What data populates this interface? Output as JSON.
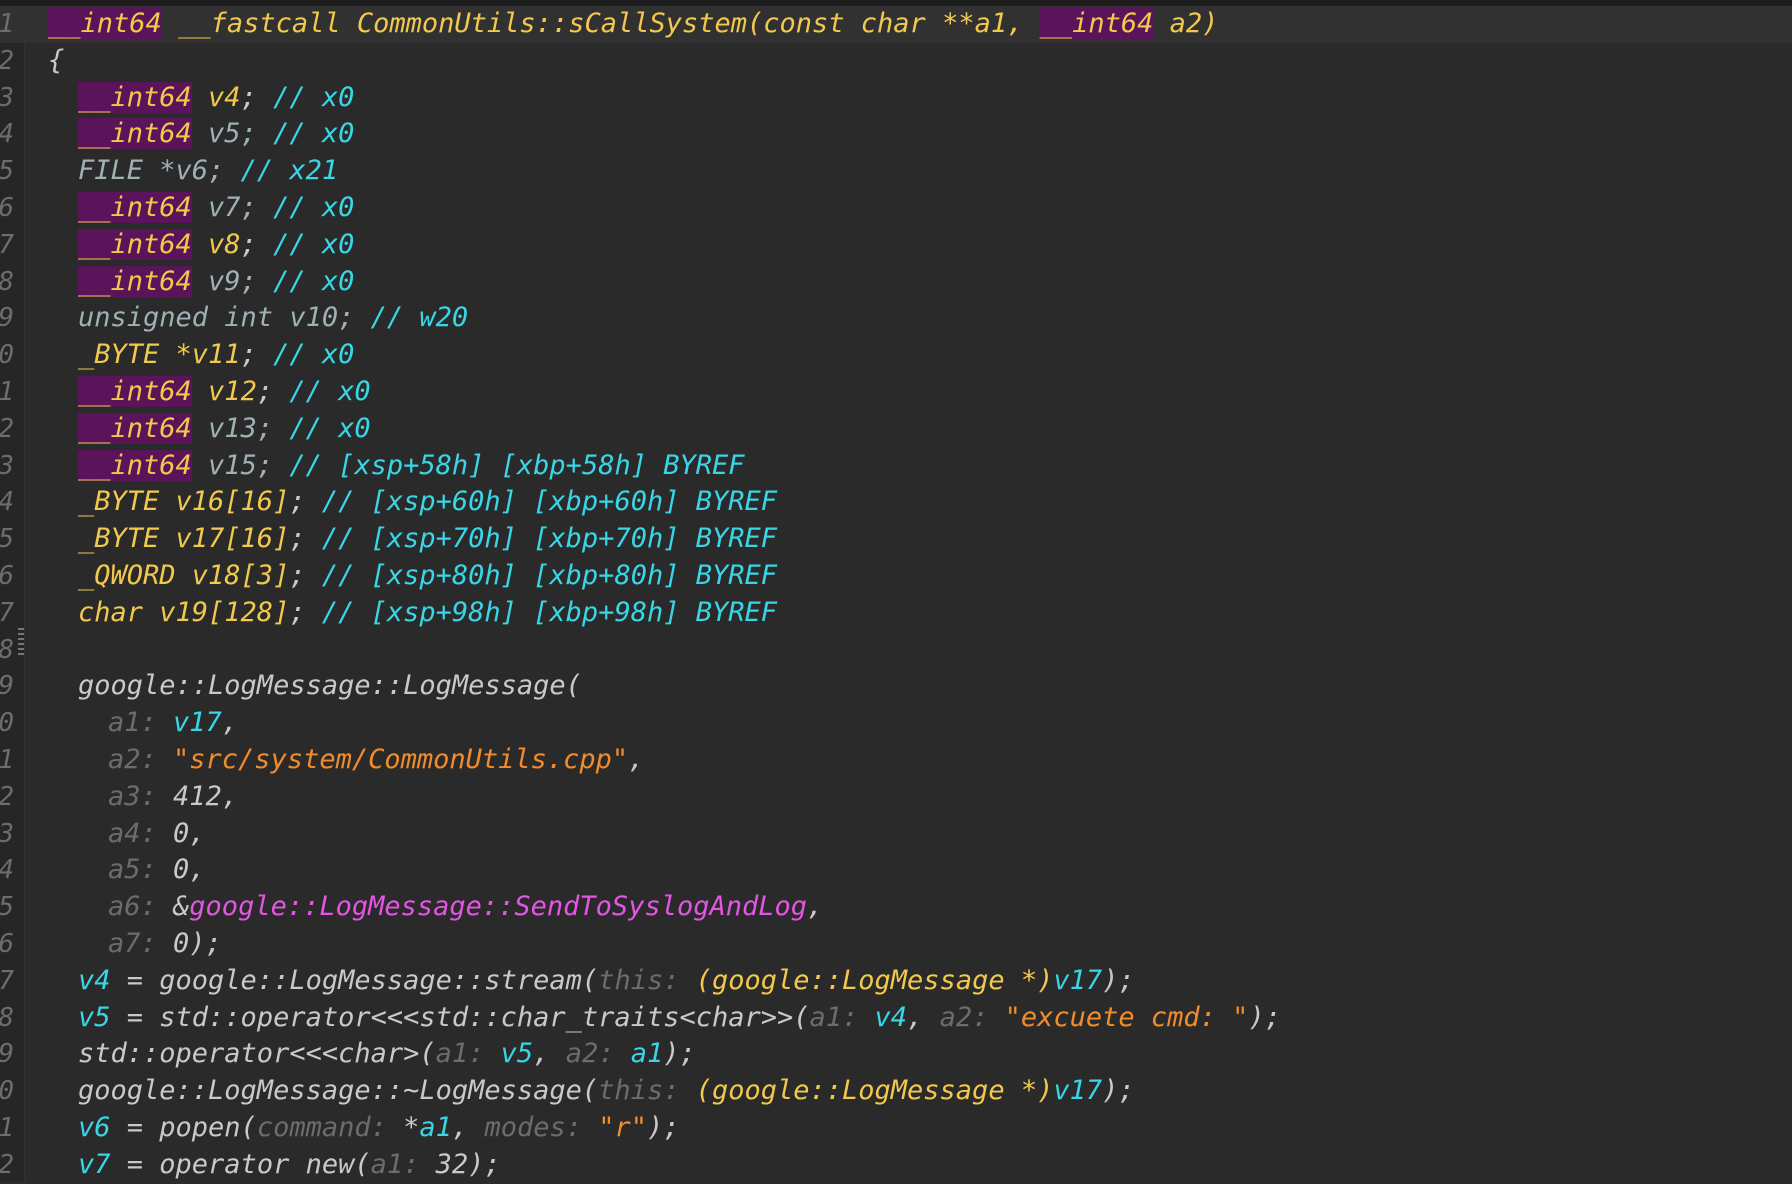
{
  "colors": {
    "background": "#2a2a2a",
    "keyword": "#f2c94c",
    "variable": "#38d6e6",
    "string": "#f28c2a",
    "import": "#e455e4",
    "hint": "#6c6c6c",
    "highlight": "#5b1459"
  },
  "lines": [
    {
      "n": "1",
      "indent": 48,
      "current": true,
      "tokens": [
        {
          "c": "hl",
          "t": "__int64"
        },
        {
          "c": "def",
          "t": " "
        },
        {
          "c": "kw",
          "t": "__fastcall CommonUtils::sCallSystem(const char **a1, "
        },
        {
          "c": "hl",
          "t": "__int64"
        },
        {
          "c": "kw",
          "t": " a2)"
        }
      ]
    },
    {
      "n": "2",
      "indent": 48,
      "tokens": [
        {
          "c": "def",
          "t": "{"
        }
      ]
    },
    {
      "n": "3",
      "indent": 78,
      "tokens": [
        {
          "c": "hl",
          "t": "__int64"
        },
        {
          "c": "kw",
          "t": " v4"
        },
        {
          "c": "def",
          "t": "; "
        },
        {
          "c": "cmt",
          "t": "// x0"
        }
      ]
    },
    {
      "n": "4",
      "indent": 78,
      "tokens": [
        {
          "c": "hl",
          "t": "__int64"
        },
        {
          "c": "dim",
          "t": " v5; "
        },
        {
          "c": "cmt",
          "t": "// x0"
        }
      ]
    },
    {
      "n": "5",
      "indent": 78,
      "tokens": [
        {
          "c": "dim",
          "t": "FILE *v6; "
        },
        {
          "c": "cmt",
          "t": "// x21"
        }
      ]
    },
    {
      "n": "6",
      "indent": 78,
      "tokens": [
        {
          "c": "hl",
          "t": "__int64"
        },
        {
          "c": "dim",
          "t": " v7; "
        },
        {
          "c": "cmt",
          "t": "// x0"
        }
      ]
    },
    {
      "n": "7",
      "indent": 78,
      "tokens": [
        {
          "c": "hl",
          "t": "__int64"
        },
        {
          "c": "kw",
          "t": " v8"
        },
        {
          "c": "def",
          "t": "; "
        },
        {
          "c": "cmt",
          "t": "// x0"
        }
      ]
    },
    {
      "n": "8",
      "indent": 78,
      "tokens": [
        {
          "c": "hl",
          "t": "__int64"
        },
        {
          "c": "dim",
          "t": " v9; "
        },
        {
          "c": "cmt",
          "t": "// x0"
        }
      ]
    },
    {
      "n": "9",
      "indent": 78,
      "tokens": [
        {
          "c": "dim",
          "t": "unsigned int v10; "
        },
        {
          "c": "cmt",
          "t": "// w20"
        }
      ]
    },
    {
      "n": "0",
      "indent": 78,
      "tokens": [
        {
          "c": "kw",
          "t": "_BYTE *v11"
        },
        {
          "c": "def",
          "t": "; "
        },
        {
          "c": "cmt",
          "t": "// x0"
        }
      ]
    },
    {
      "n": "1",
      "indent": 78,
      "tokens": [
        {
          "c": "hl",
          "t": "__int64"
        },
        {
          "c": "kw",
          "t": " v12"
        },
        {
          "c": "def",
          "t": "; "
        },
        {
          "c": "cmt",
          "t": "// x0"
        }
      ]
    },
    {
      "n": "2",
      "indent": 78,
      "tokens": [
        {
          "c": "hl",
          "t": "__int64"
        },
        {
          "c": "dim",
          "t": " v13; "
        },
        {
          "c": "cmt",
          "t": "// x0"
        }
      ]
    },
    {
      "n": "3",
      "indent": 78,
      "tokens": [
        {
          "c": "hl",
          "t": "__int64"
        },
        {
          "c": "dim",
          "t": " v15; "
        },
        {
          "c": "cmt",
          "t": "// [xsp+58h] [xbp+58h] BYREF"
        }
      ]
    },
    {
      "n": "4",
      "indent": 78,
      "tokens": [
        {
          "c": "kw",
          "t": "_BYTE v16[16]"
        },
        {
          "c": "def",
          "t": "; "
        },
        {
          "c": "cmt",
          "t": "// [xsp+60h] [xbp+60h] BYREF"
        }
      ]
    },
    {
      "n": "5",
      "indent": 78,
      "tokens": [
        {
          "c": "kw",
          "t": "_BYTE v17[16]"
        },
        {
          "c": "def",
          "t": "; "
        },
        {
          "c": "cmt",
          "t": "// [xsp+70h] [xbp+70h] BYREF"
        }
      ]
    },
    {
      "n": "6",
      "indent": 78,
      "tokens": [
        {
          "c": "kw",
          "t": "_QWORD v18[3]"
        },
        {
          "c": "def",
          "t": "; "
        },
        {
          "c": "cmt",
          "t": "// [xsp+80h] [xbp+80h] BYREF"
        }
      ]
    },
    {
      "n": "7",
      "indent": 78,
      "tokens": [
        {
          "c": "kw",
          "t": "char v19[128]"
        },
        {
          "c": "def",
          "t": "; "
        },
        {
          "c": "cmt",
          "t": "// [xsp+98h] [xbp+98h] BYREF"
        }
      ]
    },
    {
      "n": "8",
      "indent": 78,
      "tokens": []
    },
    {
      "n": "9",
      "indent": 78,
      "tokens": [
        {
          "c": "def",
          "t": "google::LogMessage::LogMessage("
        }
      ]
    },
    {
      "n": "0",
      "indent": 108,
      "tokens": [
        {
          "c": "hint",
          "t": "a1: "
        },
        {
          "c": "var",
          "t": "v17"
        },
        {
          "c": "def",
          "t": ","
        }
      ]
    },
    {
      "n": "1",
      "indent": 108,
      "tokens": [
        {
          "c": "hint",
          "t": "a2: "
        },
        {
          "c": "str",
          "t": "\"src/system/CommonUtils.cpp\""
        },
        {
          "c": "def",
          "t": ","
        }
      ]
    },
    {
      "n": "2",
      "indent": 108,
      "tokens": [
        {
          "c": "hint",
          "t": "a3: "
        },
        {
          "c": "num",
          "t": "412"
        },
        {
          "c": "def",
          "t": ","
        }
      ]
    },
    {
      "n": "3",
      "indent": 108,
      "tokens": [
        {
          "c": "hint",
          "t": "a4: "
        },
        {
          "c": "num",
          "t": "0"
        },
        {
          "c": "def",
          "t": ","
        }
      ]
    },
    {
      "n": "4",
      "indent": 108,
      "tokens": [
        {
          "c": "hint",
          "t": "a5: "
        },
        {
          "c": "num",
          "t": "0"
        },
        {
          "c": "def",
          "t": ","
        }
      ]
    },
    {
      "n": "5",
      "indent": 108,
      "tokens": [
        {
          "c": "hint",
          "t": "a6: "
        },
        {
          "c": "def",
          "t": "&"
        },
        {
          "c": "imp",
          "t": "google::LogMessage::SendToSyslogAndLog"
        },
        {
          "c": "def",
          "t": ","
        }
      ]
    },
    {
      "n": "6",
      "indent": 108,
      "tokens": [
        {
          "c": "hint",
          "t": "a7: "
        },
        {
          "c": "num",
          "t": "0"
        },
        {
          "c": "def",
          "t": ");"
        }
      ]
    },
    {
      "n": "7",
      "indent": 78,
      "tokens": [
        {
          "c": "var",
          "t": "v4"
        },
        {
          "c": "def",
          "t": " = google::LogMessage::stream("
        },
        {
          "c": "hint",
          "t": "this: "
        },
        {
          "c": "kw",
          "t": "(google::LogMessage *)"
        },
        {
          "c": "var",
          "t": "v17"
        },
        {
          "c": "def",
          "t": ");"
        }
      ]
    },
    {
      "n": "8",
      "indent": 78,
      "tokens": [
        {
          "c": "var",
          "t": "v5"
        },
        {
          "c": "def",
          "t": " = std::operator<<<std::char_traits<char>>("
        },
        {
          "c": "hint",
          "t": "a1: "
        },
        {
          "c": "var",
          "t": "v4"
        },
        {
          "c": "def",
          "t": ", "
        },
        {
          "c": "hint",
          "t": "a2: "
        },
        {
          "c": "str",
          "t": "\"excuete cmd: \""
        },
        {
          "c": "def",
          "t": ");"
        }
      ]
    },
    {
      "n": "9",
      "indent": 78,
      "tokens": [
        {
          "c": "def",
          "t": "std::operator<<<char>("
        },
        {
          "c": "hint",
          "t": "a1: "
        },
        {
          "c": "var",
          "t": "v5"
        },
        {
          "c": "def",
          "t": ", "
        },
        {
          "c": "hint",
          "t": "a2: "
        },
        {
          "c": "var",
          "t": "a1"
        },
        {
          "c": "def",
          "t": ");"
        }
      ]
    },
    {
      "n": "0",
      "indent": 78,
      "tokens": [
        {
          "c": "def",
          "t": "google::LogMessage::~LogMessage("
        },
        {
          "c": "hint",
          "t": "this: "
        },
        {
          "c": "kw",
          "t": "(google::LogMessage *)"
        },
        {
          "c": "var",
          "t": "v17"
        },
        {
          "c": "def",
          "t": ");"
        }
      ]
    },
    {
      "n": "1",
      "indent": 78,
      "tokens": [
        {
          "c": "var",
          "t": "v6"
        },
        {
          "c": "def",
          "t": " = popen("
        },
        {
          "c": "hint",
          "t": "command: "
        },
        {
          "c": "def",
          "t": "*"
        },
        {
          "c": "var",
          "t": "a1"
        },
        {
          "c": "def",
          "t": ", "
        },
        {
          "c": "hint",
          "t": "modes: "
        },
        {
          "c": "str",
          "t": "\"r\""
        },
        {
          "c": "def",
          "t": ");"
        }
      ]
    },
    {
      "n": "2",
      "indent": 78,
      "tokens": [
        {
          "c": "var",
          "t": "v7"
        },
        {
          "c": "def",
          "t": " = operator new("
        },
        {
          "c": "hint",
          "t": "a1: "
        },
        {
          "c": "num",
          "t": "32"
        },
        {
          "c": "def",
          "t": ");"
        }
      ]
    }
  ]
}
